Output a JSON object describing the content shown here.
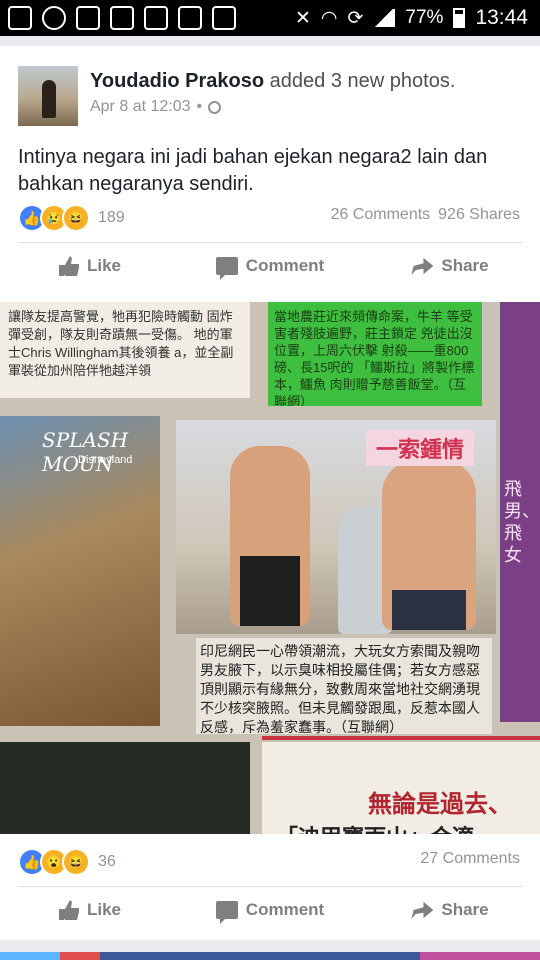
{
  "status_bar": {
    "battery": "77%",
    "time": "13:44",
    "left_icons": [
      "chat-bubble-icon",
      "whatsapp-icon",
      "gmail-icon",
      "image-icon",
      "instagram-icon",
      "gmail-icon",
      "instagram-icon"
    ],
    "right_icons": [
      "mute-icon",
      "wifi-icon",
      "sync-icon",
      "signal-icon",
      "battery-icon"
    ]
  },
  "post": {
    "author": "Youdadio Prakoso",
    "action": "added 3 new photos.",
    "date": "Apr 8 at 12:03",
    "separator": "•",
    "text": "Intinya negara ini jadi bahan ejekan negara2 lain dan bahkan negaranya sendiri.",
    "reactions": {
      "count": "189",
      "types": [
        "like",
        "sad",
        "haha"
      ]
    },
    "comments": "26 Comments",
    "shares": "926 Shares",
    "actions": {
      "like": "Like",
      "comment": "Comment",
      "share": "Share"
    }
  },
  "photo": {
    "top_left_text": "讓隊友提高警覺，牠再犯險時觸動 固炸彈受創，隊友則奇蹟無一受傷。 地的軍士Chris Willingham其後領養 a，並全副軍裝從加州陪伴牠越洋領",
    "green_box_text": "當地農莊近來頻傳命案，牛羊 等受害者殘肢遍野，莊主鎖定 兇徒出沒位置，上周六伏擊 射殺——重800磅、長15呎的 「鱷斯拉」將製作標本，鱷魚 肉則贈予慈善飯堂。（互聯網）",
    "splash_title": "SPLASH MOUN",
    "splash_subtitle": "Disneyland",
    "banner": "一索鍾情",
    "caption": "印尼網民一心帶領潮流，大玩女方索聞及親吻男友腋下，以示臭味相投屬佳偶；若女方感惡頂則顯示有緣無分，致數周來當地社交網湧現不少核突腋照。但未見觸發跟風，反惹本國人反感，斥為羞家蠢事。（互聯網）",
    "vertical_text": "飛男、飛女",
    "headline": "無論是過去、",
    "headline2": "「迪甲寶雨山」合適"
  },
  "post2": {
    "reactions": {
      "count": "36",
      "types": [
        "like",
        "wow",
        "haha"
      ]
    },
    "comments": "27 Comments",
    "actions": {
      "like": "Like",
      "comment": "Comment",
      "share": "Share"
    }
  }
}
